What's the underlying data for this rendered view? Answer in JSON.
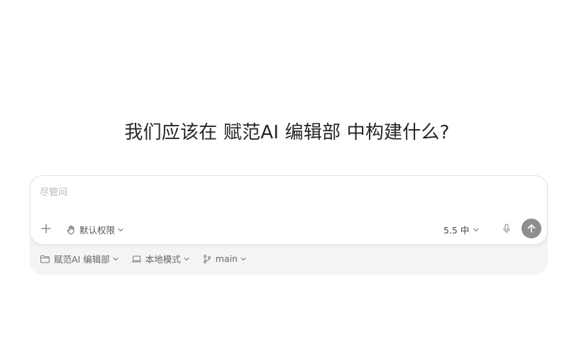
{
  "headline": "我们应该在 赋范AI 编辑部 中构建什么?",
  "composer": {
    "placeholder": "尽管问",
    "permission_label": "默认权限",
    "model_label": "5.5 中"
  },
  "footer": {
    "workspace_label": "赋范AI 编辑部",
    "mode_label": "本地模式",
    "branch_label": "main"
  },
  "colors": {
    "send_button": "#8e8e8e",
    "footer_bg": "#f4f4f4"
  },
  "icons": [
    "plus-icon",
    "hand-icon",
    "chevron-down-icon",
    "microphone-icon",
    "arrow-up-icon",
    "folder-icon",
    "laptop-icon",
    "git-branch-icon"
  ]
}
